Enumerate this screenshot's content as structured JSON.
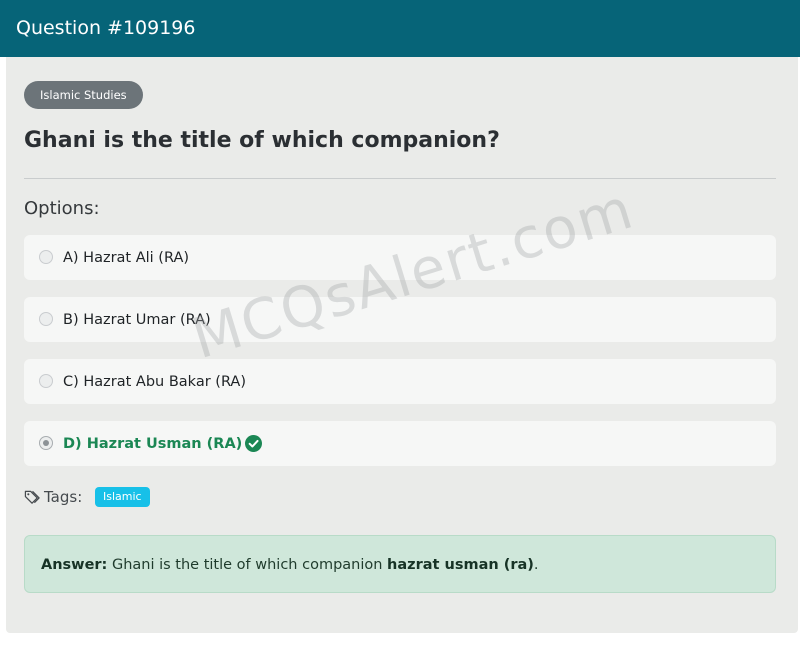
{
  "header": {
    "title": "Question #109196"
  },
  "category": {
    "label": "Islamic Studies"
  },
  "question": {
    "text": "Ghani is the title of which companion?"
  },
  "options_heading": "Options:",
  "options": [
    {
      "label": "A) Hazrat Ali (RA)",
      "selected": false,
      "correct": false
    },
    {
      "label": "B) Hazrat Umar (RA)",
      "selected": false,
      "correct": false
    },
    {
      "label": "C) Hazrat Abu Bakar (RA)",
      "selected": false,
      "correct": false
    },
    {
      "label": "D) Hazrat Usman (RA)",
      "selected": true,
      "correct": true
    }
  ],
  "tags": {
    "label": "Tags:",
    "items": [
      "Islamic"
    ]
  },
  "answer": {
    "prefix": "Answer:",
    "text": "Ghani is the title of which companion",
    "value": "hazrat usman (ra)",
    "suffix": "."
  },
  "watermark": "MCQsAlert.com",
  "colors": {
    "header": "#066478",
    "correct": "#1b8754",
    "tag_badge": "#17c0e8",
    "answer_bg": "#cfe7da"
  }
}
